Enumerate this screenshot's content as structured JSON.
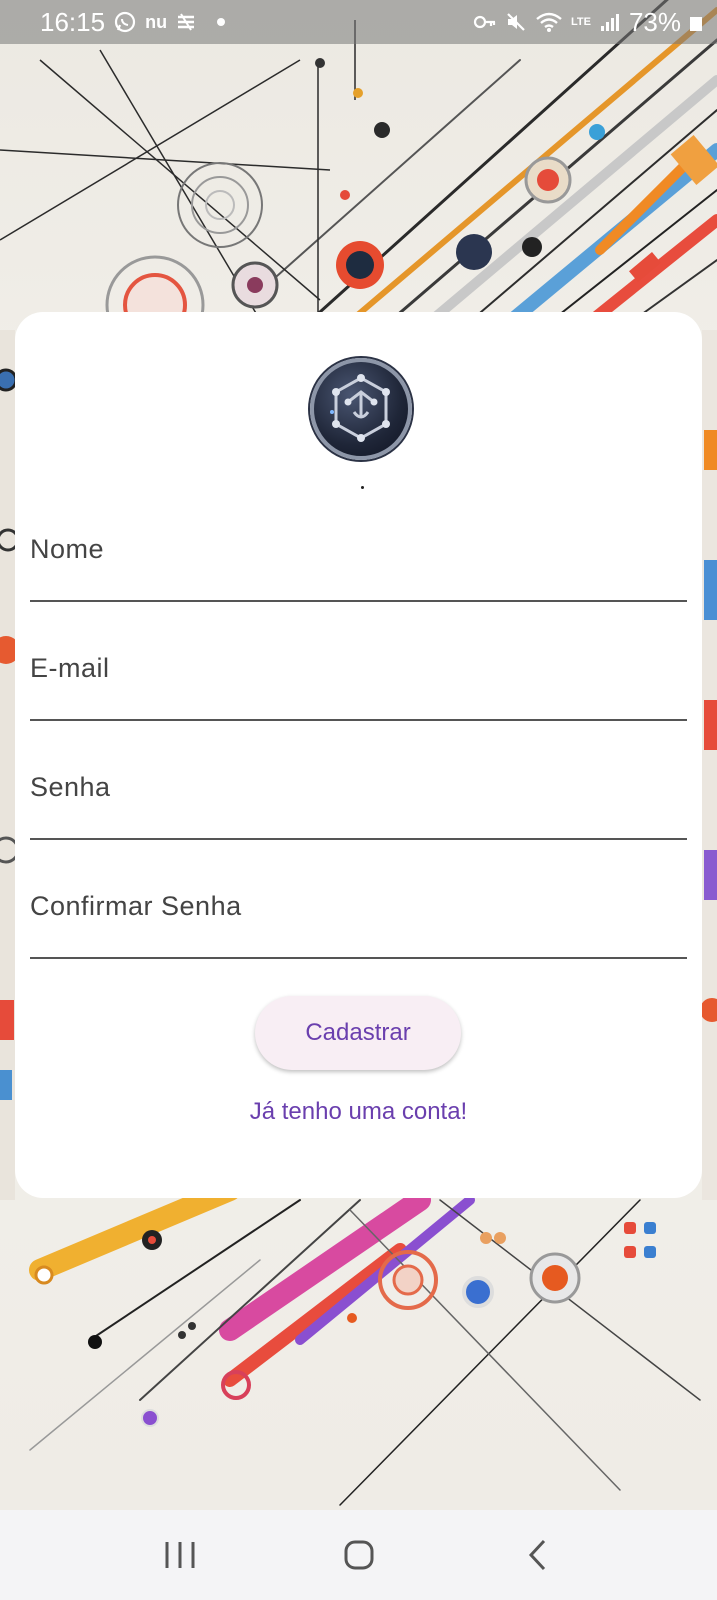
{
  "status_bar": {
    "time": "16:15",
    "app_badge_nu": "nu",
    "battery_text": "73%",
    "network_label": "LTE"
  },
  "form": {
    "fields": [
      {
        "label": "Nome"
      },
      {
        "label": "E-mail"
      },
      {
        "label": "Senha"
      },
      {
        "label": "Confirmar Senha"
      }
    ],
    "submit_label": "Cadastrar",
    "login_link": "Já tenho uma conta!"
  },
  "colors": {
    "accent": "#6a3fae",
    "button_bg": "#f8eef4",
    "card_bg": "#ffffff"
  },
  "icons": {
    "status_left": [
      "whatsapp-icon",
      "nu-icon",
      "sync-icon",
      "notification-dot"
    ],
    "status_right": [
      "key-icon",
      "mute-icon",
      "wifi-icon",
      "volte-icon",
      "signal-icon",
      "battery-icon"
    ],
    "nav": [
      "recent-apps-icon",
      "home-icon",
      "back-icon"
    ]
  }
}
